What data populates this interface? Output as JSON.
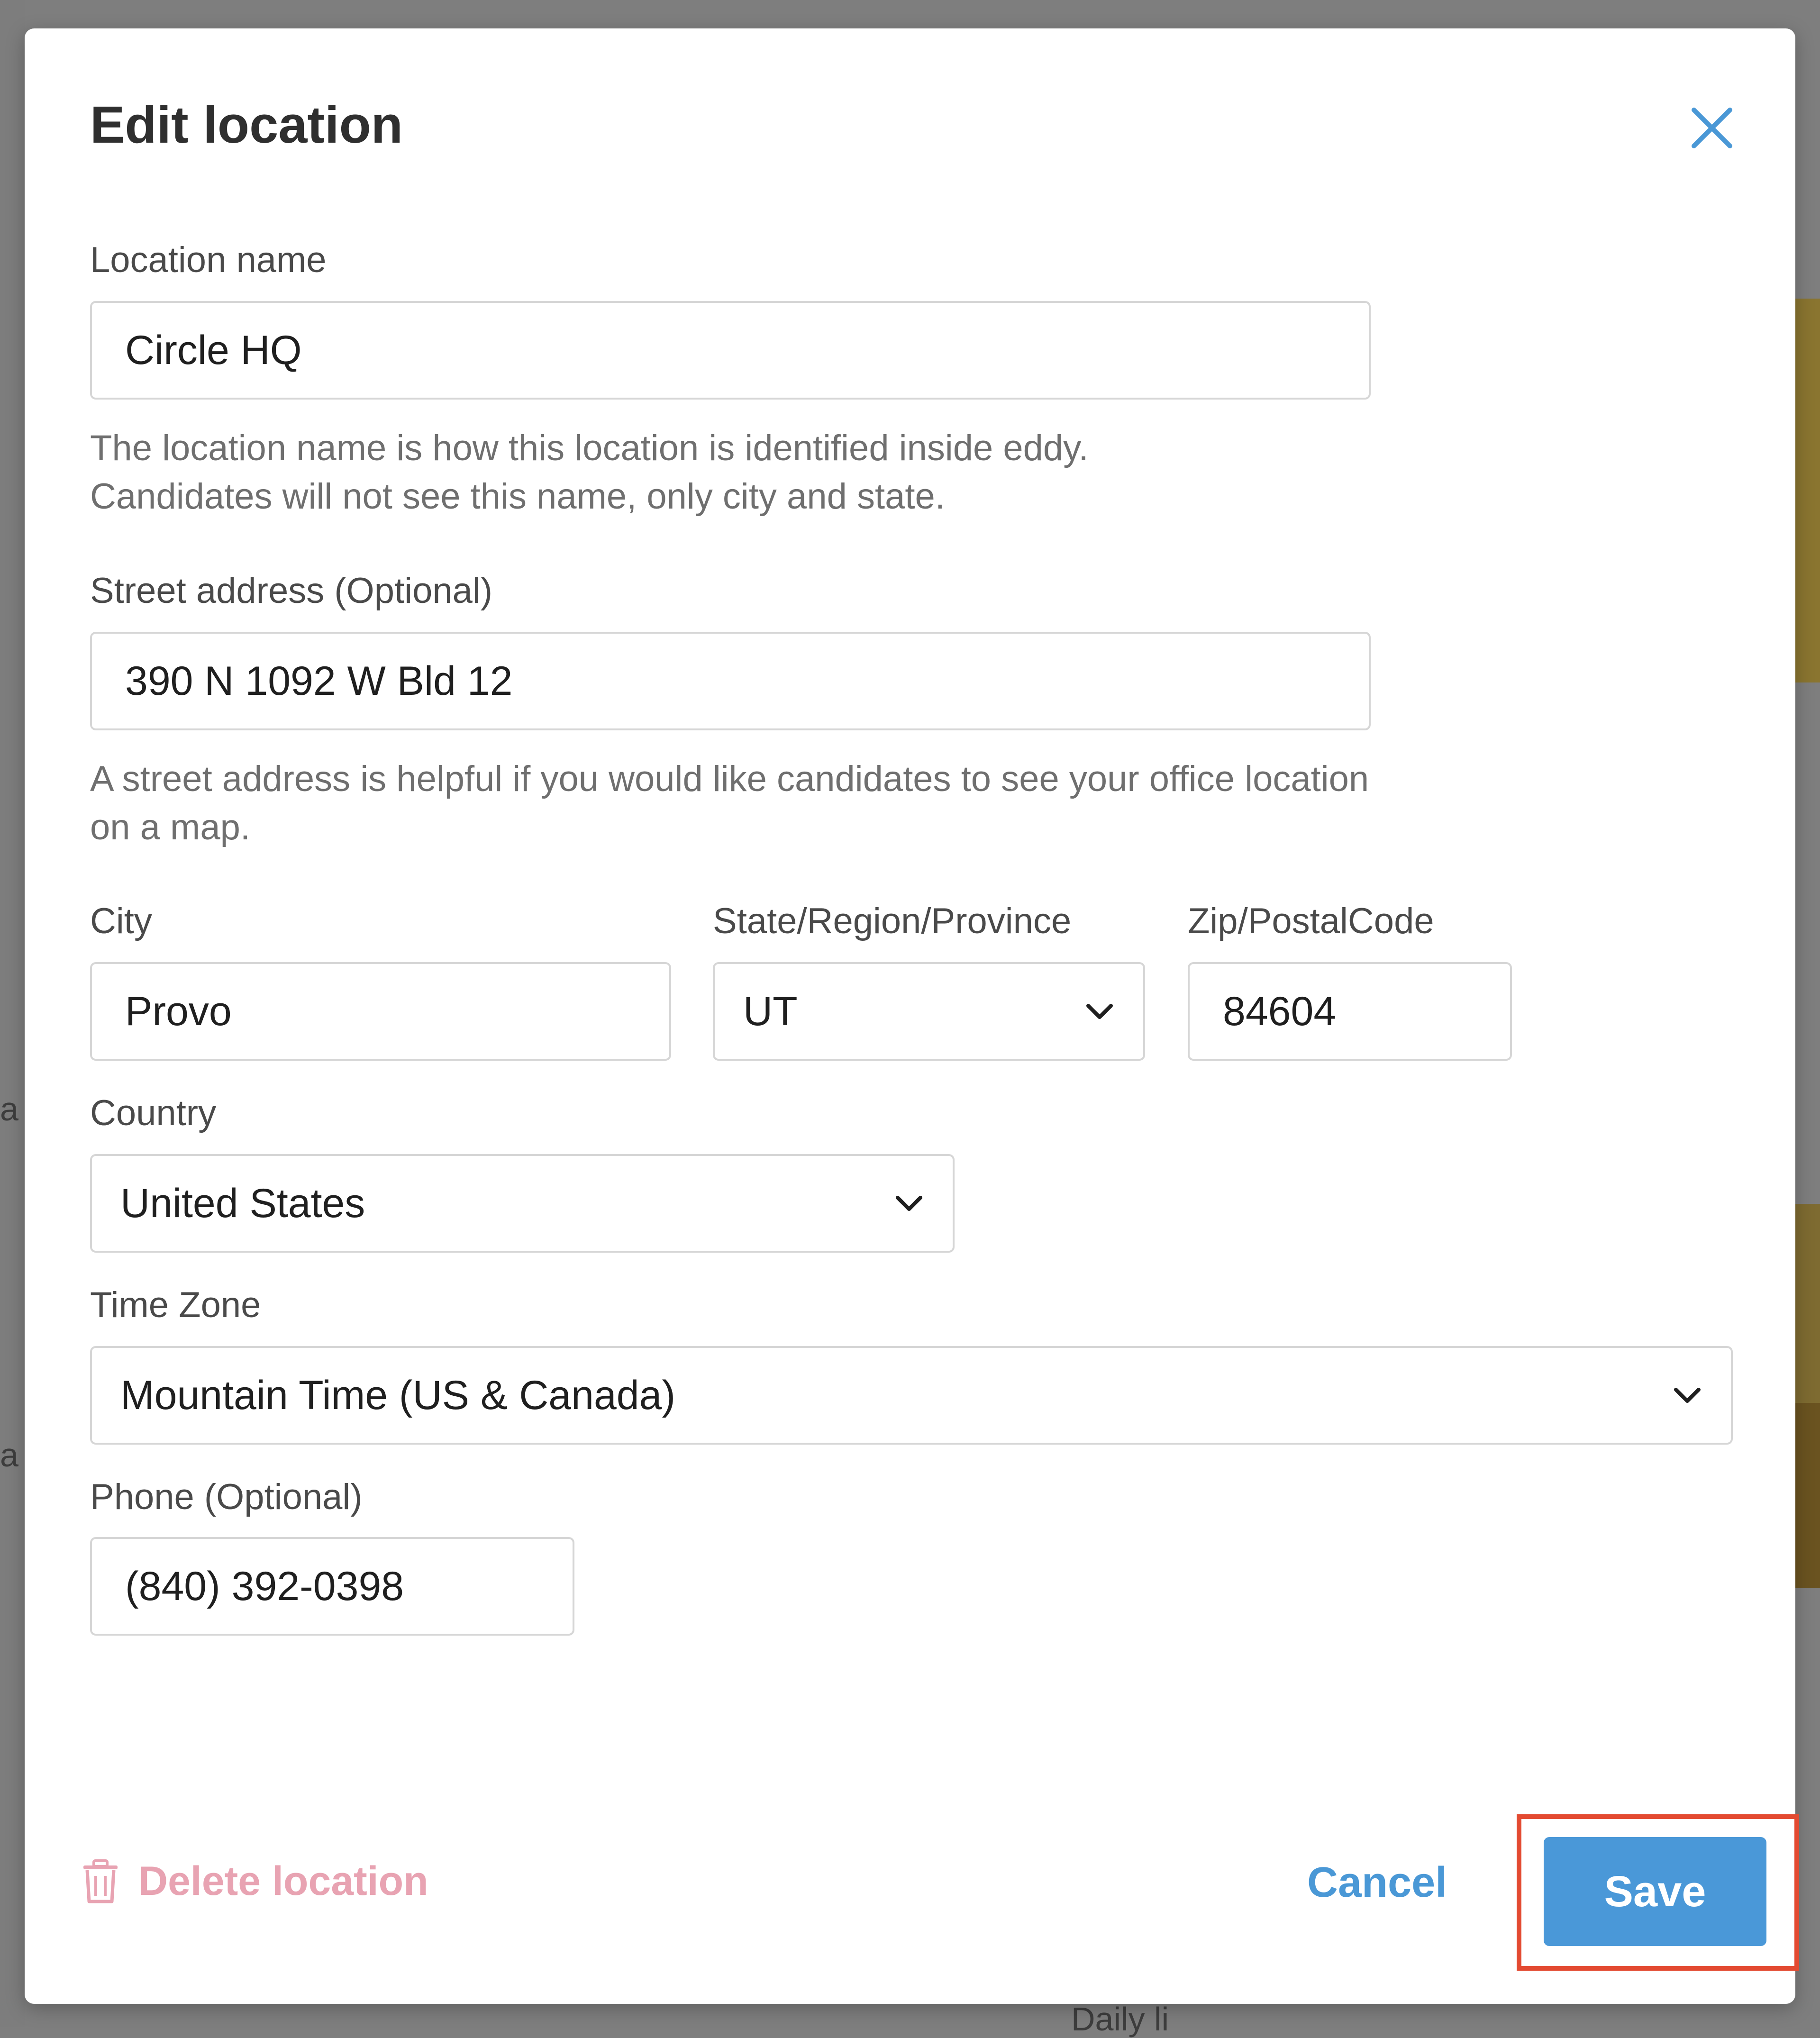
{
  "background": {
    "fragment_1": "a",
    "fragment_2": "a",
    "fragment_3": "Daily li"
  },
  "modal": {
    "title": "Edit location",
    "close_icon": "close-icon",
    "fields": {
      "location_name": {
        "label": "Location name",
        "value": "Circle HQ",
        "help": "The location name is how this location is identified inside eddy. Candidates will not see this name, only city and state."
      },
      "street_address": {
        "label": "Street address (Optional)",
        "value": "390 N 1092 W Bld 12",
        "help": "A street address is helpful if you would like candidates to see your office location on a map."
      },
      "city": {
        "label": "City",
        "value": "Provo"
      },
      "state": {
        "label": "State/Region/Province",
        "value": "UT"
      },
      "zip": {
        "label": "Zip/PostalCode",
        "value": "84604"
      },
      "country": {
        "label": "Country",
        "value": "United States"
      },
      "time_zone": {
        "label": "Time Zone",
        "value": "Mountain Time (US & Canada)"
      },
      "phone": {
        "label": "Phone (Optional)",
        "value": "(840) 392-0398"
      }
    },
    "footer": {
      "delete_label": "Delete location",
      "delete_icon": "trash-icon",
      "cancel_label": "Cancel",
      "save_label": "Save"
    }
  },
  "colors": {
    "accent": "#4a98d8",
    "delete": "#e8a3b2",
    "highlight": "#e34a31"
  }
}
